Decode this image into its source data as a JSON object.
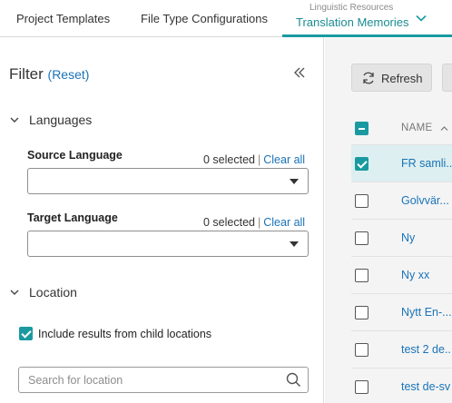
{
  "tabs": {
    "project_templates": "Project Templates",
    "file_type_configurations": "File Type Configurations",
    "linguistic_resources_group": "Linguistic Resources",
    "translation_memories": "Translation Memories"
  },
  "filter": {
    "title": "Filter",
    "reset_label": "Reset",
    "languages_section": "Languages",
    "source_language_label": "Source Language",
    "source_selected": "0 selected",
    "source_clear": "Clear all",
    "target_language_label": "Target Language",
    "target_selected": "0 selected",
    "target_clear": "Clear all",
    "location_section": "Location",
    "include_child_label": "Include results from child locations",
    "include_child_checked": true,
    "search_placeholder": "Search for location"
  },
  "list": {
    "refresh_label": "Refresh",
    "name_header": "NAME",
    "rows": [
      {
        "name": "FR samli...",
        "checked": true
      },
      {
        "name": "Golvvär...",
        "checked": false
      },
      {
        "name": "Ny",
        "checked": false
      },
      {
        "name": "Ny xx",
        "checked": false
      },
      {
        "name": "Nytt En-...",
        "checked": false
      },
      {
        "name": "test 2 de...",
        "checked": false
      },
      {
        "name": "test de-sv",
        "checked": false
      }
    ]
  },
  "colors": {
    "accent": "#1a9aa0",
    "link": "#1a73b8"
  },
  "icons": {
    "tab_dropdown": "chevron-down-icon",
    "collapse_panel": "double-chevron-left-icon",
    "section_toggle": "chevron-down-icon",
    "search": "search-icon",
    "refresh": "refresh-icon",
    "sort": "sort-ascending-icon"
  }
}
